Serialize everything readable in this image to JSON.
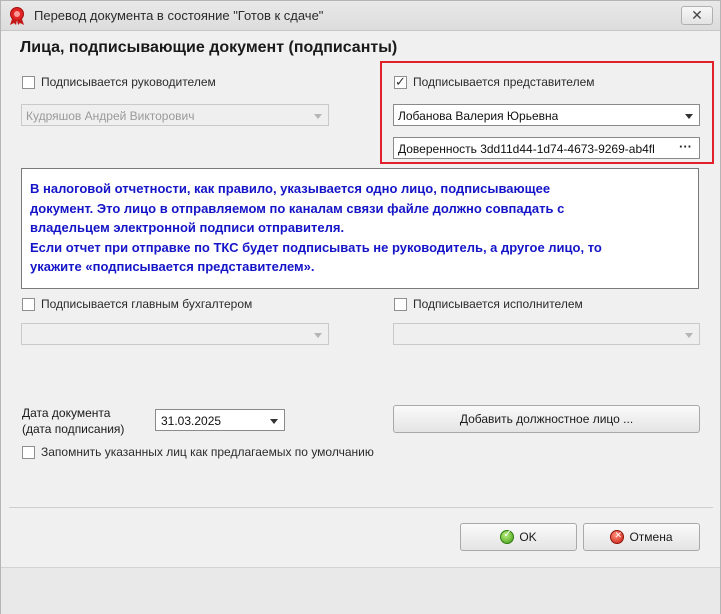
{
  "window": {
    "title": "Перевод документа в состояние \"Готов к сдаче\"",
    "close_symbol": "✕"
  },
  "heading": "Лица, подписывающие документ (подписанты)",
  "signers": {
    "head": {
      "label": "Подписывается руководителем",
      "checked": false,
      "value": "Кудряшов Андрей Викторович"
    },
    "representative": {
      "label": "Подписывается представителем",
      "checked": true,
      "value": "Лобанова Валерия Юрьевна",
      "power_of_attorney": "Доверенность  3dd11d44-1d74-4673-9269-ab4fl",
      "ellipsis": "···"
    },
    "chief_accountant": {
      "label": "Подписывается главным бухгалтером",
      "checked": false,
      "value": ""
    },
    "executor": {
      "label": "Подписывается исполнителем",
      "checked": false,
      "value": ""
    }
  },
  "info_lines": [
    "В налоговой отчетности, как правило, указывается одно лицо, подписывающее",
    "документ. Это лицо в отправляемом по каналам связи файле должно совпадать с",
    "владельцем электронной подписи отправителя.",
    "Если отчет при отправке по ТКС будет подписывать не руководитель, а другое лицо, то",
    "укажите «подписывается представителем»."
  ],
  "date": {
    "label_line1": "Дата документа",
    "label_line2": "(дата подписания)",
    "value": "31.03.2025"
  },
  "add_official_button": "Добавить должностное лицо ...",
  "remember": {
    "label": "Запомнить указанных лиц как предлагаемых по умолчанию",
    "checked": false
  },
  "buttons": {
    "ok": "OK",
    "cancel": "Отмена"
  },
  "colors": {
    "highlight_border": "#e0202a",
    "info_text": "#1414c8"
  },
  "icons": {
    "app": "red-seal-icon",
    "ok": "green-check-icon",
    "cancel": "red-cross-icon"
  }
}
